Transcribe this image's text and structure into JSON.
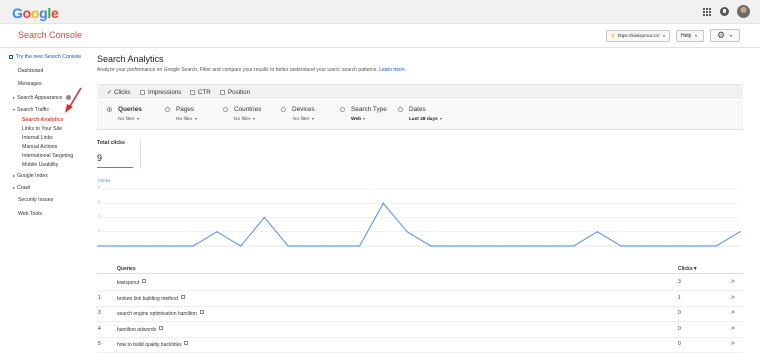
{
  "header": {
    "logo_letters": [
      {
        "ch": "G",
        "color": "#4285f4"
      },
      {
        "ch": "o",
        "color": "#ea4335"
      },
      {
        "ch": "o",
        "color": "#fbbc05"
      },
      {
        "ch": "g",
        "color": "#4285f4"
      },
      {
        "ch": "l",
        "color": "#34a853"
      },
      {
        "ch": "e",
        "color": "#ea4335"
      }
    ],
    "app_title": "Search Console",
    "site_url": "https://kiwisprout.co/",
    "help_label": "Help",
    "icons": [
      "apps-icon",
      "notifications-icon",
      "avatar",
      "gear-icon"
    ]
  },
  "sidebar": {
    "new_console": "Try the new Search Console",
    "dashboard": "Dashboard",
    "messages": "Messages",
    "search_appearance": "Search Appearance",
    "search_traffic": "Search Traffic",
    "search_analytics": "Search Analytics",
    "links_to_site": "Links to Your Site",
    "internal_links": "Internal Links",
    "manual_actions": "Manual Actions",
    "international_targeting": "International Targeting",
    "mobile_usability": "Mobile Usability",
    "google_index": "Google Index",
    "crawl": "Crawl",
    "security_issues": "Security Issues",
    "web_tools": "Web Tools"
  },
  "main": {
    "title": "Search Analytics",
    "description": "Analyze your performance on Google Search. Filter and compare your results to better understand your users' search patterns.",
    "learn_more": "Learn more.",
    "metrics": {
      "clicks": "Clicks",
      "impressions": "Impressions",
      "ctr": "CTR",
      "position": "Position"
    },
    "dimensions": {
      "queries": {
        "label": "Queries",
        "sub": "No filter"
      },
      "pages": {
        "label": "Pages",
        "sub": "No filter"
      },
      "countries": {
        "label": "Countries",
        "sub": "No filter"
      },
      "devices": {
        "label": "Devices",
        "sub": "No filter"
      },
      "search_type": {
        "label": "Search Type",
        "sub": "Web"
      },
      "dates": {
        "label": "Dates",
        "sub": "Last 28 days"
      }
    },
    "total": {
      "label": "Total clicks",
      "value": "9"
    }
  },
  "chart_data": {
    "type": "line",
    "ylabel": "Clicks",
    "y_ticks": [
      "4",
      "3",
      "2",
      "1"
    ],
    "ylim": [
      0,
      4
    ],
    "x": [
      1,
      2,
      3,
      4,
      5,
      6,
      7,
      8,
      9,
      10,
      11,
      12,
      13,
      14,
      15,
      16,
      17,
      18,
      19,
      20,
      21,
      22,
      23,
      24,
      25,
      26,
      27,
      28
    ],
    "series": [
      {
        "values": [
          0,
          0,
          0,
          0,
          0,
          1,
          0,
          2,
          0,
          0,
          0,
          0,
          3,
          1,
          0,
          0,
          0,
          0,
          0,
          0,
          0,
          1,
          0,
          0,
          0,
          0,
          0,
          1
        ]
      }
    ],
    "color": "#4285f4",
    "grid": true
  },
  "table": {
    "header_query": "Queries",
    "header_clicks": "Clicks▼",
    "rows": [
      {
        "num": "",
        "query": "kiwisprout",
        "clicks": "3"
      },
      {
        "num": "1",
        "query": "broken link building method",
        "clicks": "1"
      },
      {
        "num": "3",
        "query": "search engine optimisation hamilton",
        "clicks": "0"
      },
      {
        "num": "4",
        "query": "hamilton adwords",
        "clicks": "0"
      },
      {
        "num": "5",
        "query": "how to build quality backlinks",
        "clicks": "0"
      }
    ],
    "open_glyph": "»"
  }
}
